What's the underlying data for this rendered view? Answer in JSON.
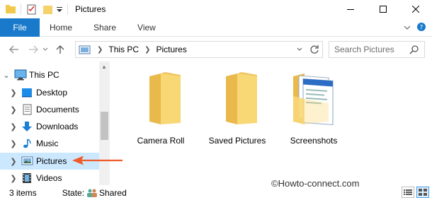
{
  "titlebar": {
    "title": "Pictures"
  },
  "ribbon": {
    "tabs": [
      "File",
      "Home",
      "Share",
      "View"
    ]
  },
  "address": {
    "crumbs": [
      "This PC",
      "Pictures"
    ]
  },
  "search": {
    "placeholder": "Search Pictures"
  },
  "nav": {
    "items": [
      {
        "label": "This PC",
        "icon": "pc-icon"
      },
      {
        "label": "Desktop",
        "icon": "desktop-icon"
      },
      {
        "label": "Documents",
        "icon": "documents-icon"
      },
      {
        "label": "Downloads",
        "icon": "downloads-icon"
      },
      {
        "label": "Music",
        "icon": "music-icon"
      },
      {
        "label": "Pictures",
        "icon": "pictures-icon",
        "selected": true
      },
      {
        "label": "Videos",
        "icon": "videos-icon"
      }
    ]
  },
  "content": {
    "folders": [
      {
        "label": "Camera Roll"
      },
      {
        "label": "Saved Pictures"
      },
      {
        "label": "Screenshots"
      }
    ]
  },
  "status": {
    "count": "3 items",
    "state_label": "State:",
    "state_value": "Shared"
  },
  "watermark": "©Howto-connect.com",
  "colors": {
    "accent": "#1979ca",
    "selected": "#cce8ff",
    "folder": "#f8d775",
    "arrow": "#f05a28"
  }
}
